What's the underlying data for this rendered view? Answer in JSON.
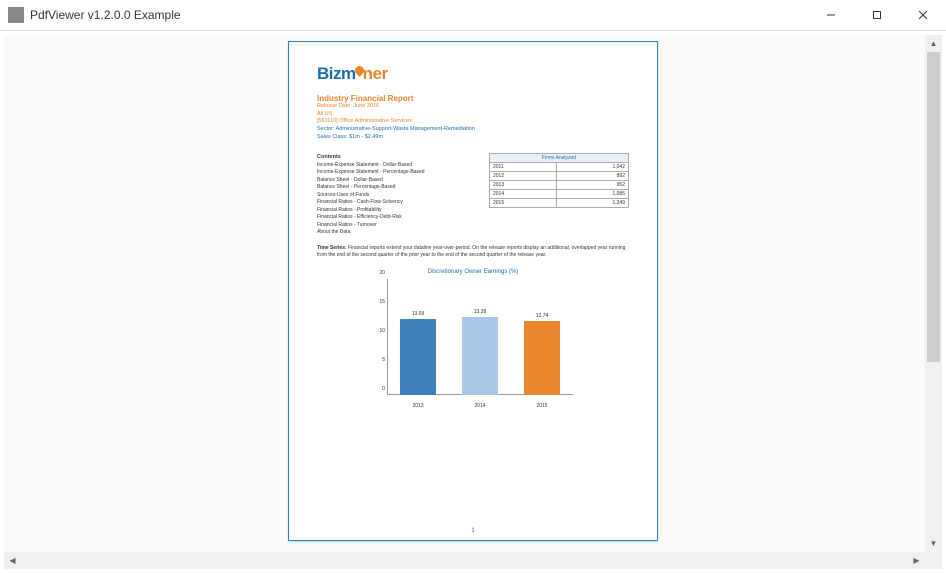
{
  "window": {
    "title": "PdfViewer v1.2.0.0 Example"
  },
  "doc": {
    "logo": {
      "part1": "Bizm",
      "part2": "ner"
    },
    "report_title": "Industry Financial Report",
    "release": "Release Date: June 2016",
    "line1": "All US",
    "line2": "[561110] Office Administrative Services",
    "line3": "Sector: Administrative-Support-Waste Management-Remediation",
    "line4": "Sales Class: $1m - $2.49m",
    "contents_hdr": "Contents",
    "contents": [
      "Income-Expense Statement - Dollar-Based",
      "Income-Expense Statement - Percentage-Based",
      "Balance Sheet - Dollar-Based",
      "Balance Sheet - Percentage-Based",
      "Sources-Uses of Funds",
      "Financial Ratios - Cash-Flow-Solvency",
      "Financial Ratios - Profitability",
      "Financial Ratios - Efficiency-Debt-Risk",
      "Financial Ratios - Turnover",
      "About the Data"
    ],
    "firms_hdr": "Firms Analyzed",
    "firms": [
      {
        "year": "2011",
        "count": "1,042"
      },
      {
        "year": "2012",
        "count": "892"
      },
      {
        "year": "2013",
        "count": "952"
      },
      {
        "year": "2014",
        "count": "1,085"
      },
      {
        "year": "2015",
        "count": "1,249"
      }
    ],
    "note_label": "Time Series:",
    "note_text": " Financial reports extend your dataline year-over-period. On the release reports display an additional, overlapped year running from the end of the second quarter of the prior year to the end of the second quarter of the release year.",
    "chart_title": "Discretionary Owner Earnings (%)",
    "page_no": "1"
  },
  "chart_data": {
    "type": "bar",
    "title": "Discretionary Owner Earnings (%)",
    "categories": [
      "2013",
      "2014",
      "2015"
    ],
    "values": [
      13.09,
      13.38,
      12.74
    ],
    "xlabel": "",
    "ylabel": "",
    "ylim": [
      0,
      20
    ],
    "yticks": [
      0,
      5,
      10,
      15,
      20
    ],
    "colors": [
      "#3c81ba",
      "#a7c9e7",
      "#e8862e"
    ]
  }
}
